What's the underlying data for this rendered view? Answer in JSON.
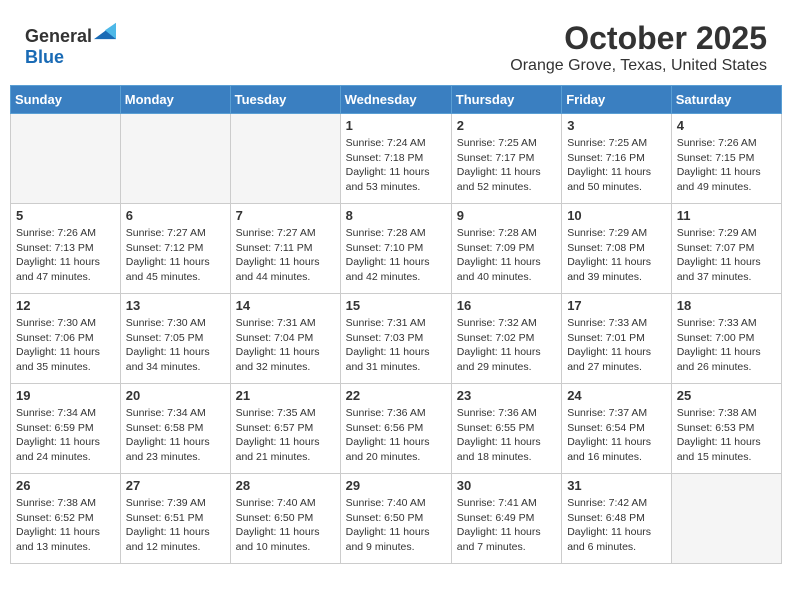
{
  "header": {
    "logo_general": "General",
    "logo_blue": "Blue",
    "month": "October 2025",
    "location": "Orange Grove, Texas, United States"
  },
  "days_of_week": [
    "Sunday",
    "Monday",
    "Tuesday",
    "Wednesday",
    "Thursday",
    "Friday",
    "Saturday"
  ],
  "weeks": [
    [
      {
        "day": "",
        "info": ""
      },
      {
        "day": "",
        "info": ""
      },
      {
        "day": "",
        "info": ""
      },
      {
        "day": "1",
        "info": "Sunrise: 7:24 AM\nSunset: 7:18 PM\nDaylight: 11 hours and 53 minutes."
      },
      {
        "day": "2",
        "info": "Sunrise: 7:25 AM\nSunset: 7:17 PM\nDaylight: 11 hours and 52 minutes."
      },
      {
        "day": "3",
        "info": "Sunrise: 7:25 AM\nSunset: 7:16 PM\nDaylight: 11 hours and 50 minutes."
      },
      {
        "day": "4",
        "info": "Sunrise: 7:26 AM\nSunset: 7:15 PM\nDaylight: 11 hours and 49 minutes."
      }
    ],
    [
      {
        "day": "5",
        "info": "Sunrise: 7:26 AM\nSunset: 7:13 PM\nDaylight: 11 hours and 47 minutes."
      },
      {
        "day": "6",
        "info": "Sunrise: 7:27 AM\nSunset: 7:12 PM\nDaylight: 11 hours and 45 minutes."
      },
      {
        "day": "7",
        "info": "Sunrise: 7:27 AM\nSunset: 7:11 PM\nDaylight: 11 hours and 44 minutes."
      },
      {
        "day": "8",
        "info": "Sunrise: 7:28 AM\nSunset: 7:10 PM\nDaylight: 11 hours and 42 minutes."
      },
      {
        "day": "9",
        "info": "Sunrise: 7:28 AM\nSunset: 7:09 PM\nDaylight: 11 hours and 40 minutes."
      },
      {
        "day": "10",
        "info": "Sunrise: 7:29 AM\nSunset: 7:08 PM\nDaylight: 11 hours and 39 minutes."
      },
      {
        "day": "11",
        "info": "Sunrise: 7:29 AM\nSunset: 7:07 PM\nDaylight: 11 hours and 37 minutes."
      }
    ],
    [
      {
        "day": "12",
        "info": "Sunrise: 7:30 AM\nSunset: 7:06 PM\nDaylight: 11 hours and 35 minutes."
      },
      {
        "day": "13",
        "info": "Sunrise: 7:30 AM\nSunset: 7:05 PM\nDaylight: 11 hours and 34 minutes."
      },
      {
        "day": "14",
        "info": "Sunrise: 7:31 AM\nSunset: 7:04 PM\nDaylight: 11 hours and 32 minutes."
      },
      {
        "day": "15",
        "info": "Sunrise: 7:31 AM\nSunset: 7:03 PM\nDaylight: 11 hours and 31 minutes."
      },
      {
        "day": "16",
        "info": "Sunrise: 7:32 AM\nSunset: 7:02 PM\nDaylight: 11 hours and 29 minutes."
      },
      {
        "day": "17",
        "info": "Sunrise: 7:33 AM\nSunset: 7:01 PM\nDaylight: 11 hours and 27 minutes."
      },
      {
        "day": "18",
        "info": "Sunrise: 7:33 AM\nSunset: 7:00 PM\nDaylight: 11 hours and 26 minutes."
      }
    ],
    [
      {
        "day": "19",
        "info": "Sunrise: 7:34 AM\nSunset: 6:59 PM\nDaylight: 11 hours and 24 minutes."
      },
      {
        "day": "20",
        "info": "Sunrise: 7:34 AM\nSunset: 6:58 PM\nDaylight: 11 hours and 23 minutes."
      },
      {
        "day": "21",
        "info": "Sunrise: 7:35 AM\nSunset: 6:57 PM\nDaylight: 11 hours and 21 minutes."
      },
      {
        "day": "22",
        "info": "Sunrise: 7:36 AM\nSunset: 6:56 PM\nDaylight: 11 hours and 20 minutes."
      },
      {
        "day": "23",
        "info": "Sunrise: 7:36 AM\nSunset: 6:55 PM\nDaylight: 11 hours and 18 minutes."
      },
      {
        "day": "24",
        "info": "Sunrise: 7:37 AM\nSunset: 6:54 PM\nDaylight: 11 hours and 16 minutes."
      },
      {
        "day": "25",
        "info": "Sunrise: 7:38 AM\nSunset: 6:53 PM\nDaylight: 11 hours and 15 minutes."
      }
    ],
    [
      {
        "day": "26",
        "info": "Sunrise: 7:38 AM\nSunset: 6:52 PM\nDaylight: 11 hours and 13 minutes."
      },
      {
        "day": "27",
        "info": "Sunrise: 7:39 AM\nSunset: 6:51 PM\nDaylight: 11 hours and 12 minutes."
      },
      {
        "day": "28",
        "info": "Sunrise: 7:40 AM\nSunset: 6:50 PM\nDaylight: 11 hours and 10 minutes."
      },
      {
        "day": "29",
        "info": "Sunrise: 7:40 AM\nSunset: 6:50 PM\nDaylight: 11 hours and 9 minutes."
      },
      {
        "day": "30",
        "info": "Sunrise: 7:41 AM\nSunset: 6:49 PM\nDaylight: 11 hours and 7 minutes."
      },
      {
        "day": "31",
        "info": "Sunrise: 7:42 AM\nSunset: 6:48 PM\nDaylight: 11 hours and 6 minutes."
      },
      {
        "day": "",
        "info": ""
      }
    ]
  ]
}
